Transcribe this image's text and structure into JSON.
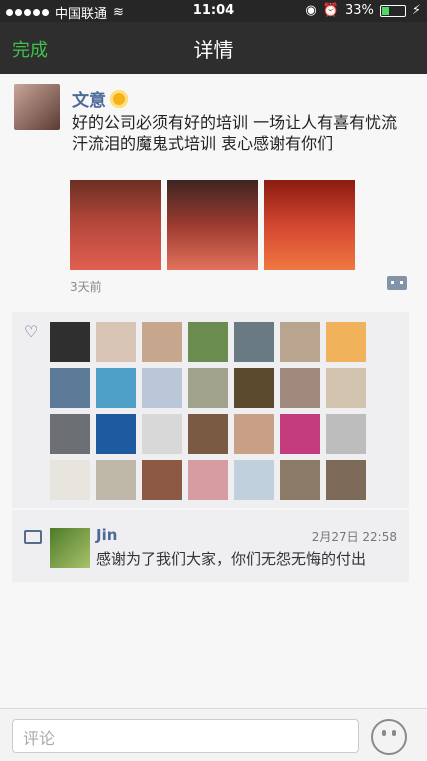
{
  "status": {
    "carrier": "中国联通",
    "time": "11:04",
    "battery": "33%"
  },
  "nav": {
    "back": "完成",
    "title": "详情"
  },
  "post": {
    "author": "文意",
    "text": "好的公司必须有好的培训 一场让人有喜有忧流汗流泪的魔鬼式培训 衷心感谢有你们",
    "time": "3天前"
  },
  "likes": {
    "avatars": [
      "#2f2f2f",
      "#d9c5b5",
      "#c7a68e",
      "#6b8c4f",
      "#6a7a83",
      "#b9a58f",
      "#f0b35b",
      "#5d7a98",
      "#4fa0c8",
      "#b9c7d9",
      "#a0a28b",
      "#5c4a2e",
      "#a08a7e",
      "#d2c4ae",
      "#6c6f73",
      "#1e5aa0",
      "#d8d8d8",
      "#7b5a43",
      "#c8a086",
      "#c43c7d",
      "#bdbdbd",
      "#e8e5df",
      "#bfb7a8",
      "#8c5a44",
      "#d69ca2",
      "#c0d0dc",
      "#8c7b66",
      "#7e6a58"
    ]
  },
  "comment": {
    "name": "Jin",
    "time": "2月27日 22:58",
    "text": "感谢为了我们大家，你们无怨无悔的付出"
  },
  "input": {
    "placeholder": "评论"
  }
}
